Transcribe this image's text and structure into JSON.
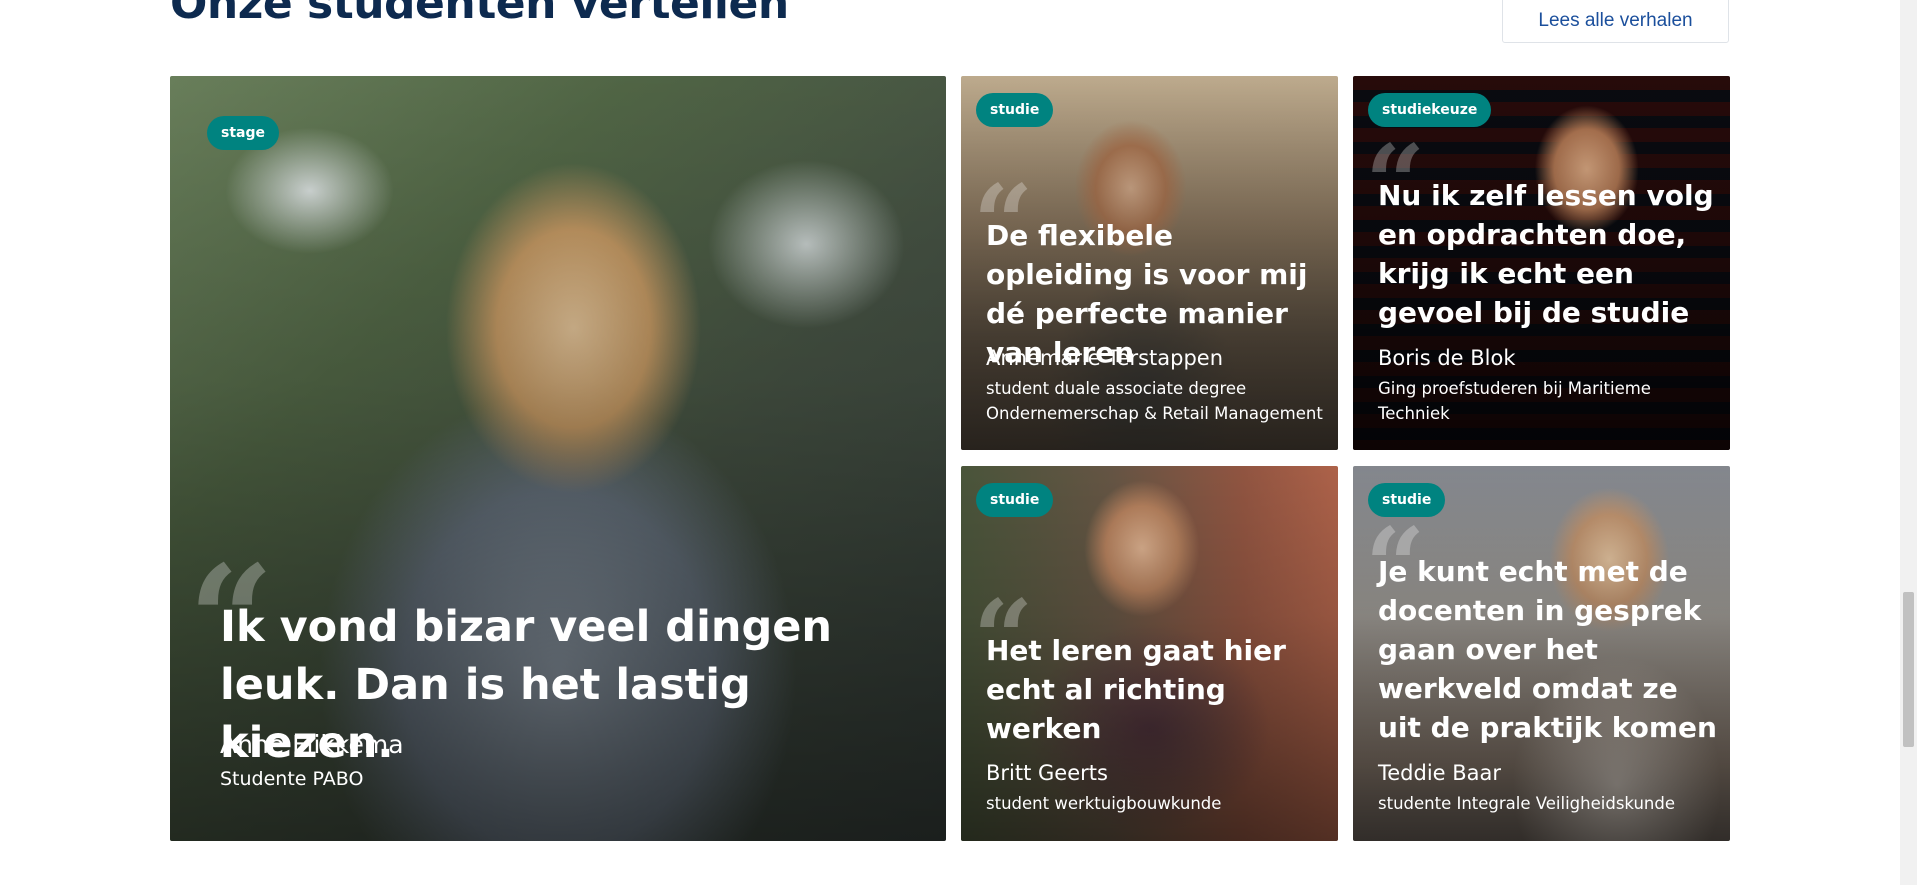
{
  "section": {
    "title": "Onze studenten vertellen",
    "read_all_label": "Lees alle verhalen"
  },
  "cards": [
    {
      "tag": "stage",
      "quote": "Ik vond bizar veel dingen leuk. Dan is het lastig kiezen.",
      "name": "Anne Flikkema",
      "role": "Studente PABO"
    },
    {
      "tag": "studie",
      "quote": "De flexibele opleiding is voor mij dé perfecte manier van leren",
      "name": "Annemarie Terstappen",
      "role": "student duale associate degree Ondernemerschap & Retail Management"
    },
    {
      "tag": "studiekeuze",
      "quote": "Nu ik zelf lessen volg en opdrachten doe, krijg ik echt een gevoel bij de studie",
      "name": "Boris de Blok",
      "role": "Ging proefstuderen bij Maritieme Techniek"
    },
    {
      "tag": "studie",
      "quote": "Het leren gaat hier echt al richting werken",
      "name": "Britt Geerts",
      "role": "student werktuigbouwkunde"
    },
    {
      "tag": "studie",
      "quote": "Je kunt echt met de docenten in gesprek gaan over het werkveld omdat ze uit de praktijk komen",
      "name": "Teddie Baar",
      "role": "studente Integrale Veiligheidskunde"
    }
  ],
  "quote_glyph": "“",
  "colors": {
    "heading": "#0d2a4f",
    "link": "#1b4f9c",
    "tag_bg": "#008380"
  }
}
